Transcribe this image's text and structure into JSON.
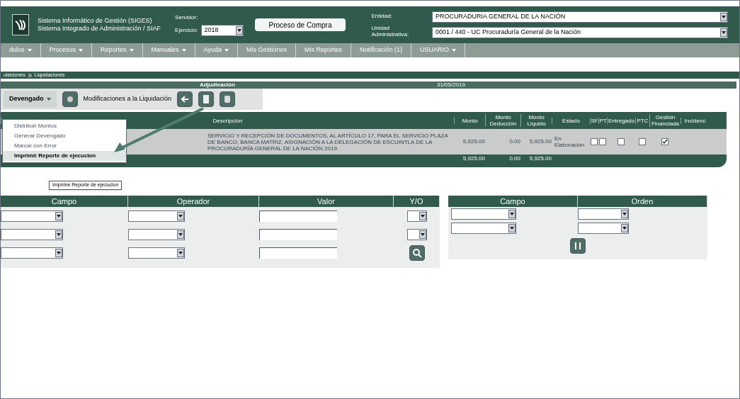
{
  "header": {
    "system_lines": [
      "Sistema Informático de Gestión (SIGES)",
      "Sistema Integrado de Administración / SIAF"
    ],
    "server_label": "Servidor:",
    "year_label": "Ejercicio:",
    "year": "2018",
    "process_button": "Proceso de Compra",
    "entity_label": "Entidad:",
    "unit_label": "Unidad Administrativa:",
    "entity": "PROCURADURIA GENERAL DE LA NACIÓN",
    "unit": "0001 / 440 - UC Procuraduría General de la Nación"
  },
  "menu": [
    {
      "label": "dulos",
      "dropdown": true
    },
    {
      "label": "Procesos",
      "dropdown": true
    },
    {
      "label": "Reportes",
      "dropdown": true
    },
    {
      "label": "Manuales",
      "dropdown": true
    },
    {
      "label": "Ayuda",
      "dropdown": true
    },
    {
      "label": "Mis Gestiones",
      "dropdown": false
    },
    {
      "label": "Mis Reportes",
      "dropdown": false
    },
    {
      "label": "Notificación (1)",
      "dropdown": false
    },
    {
      "label": "USUARIO",
      "dropdown": true
    }
  ],
  "breadcrumb": [
    "uisiciones",
    "Liquidaciones"
  ],
  "panel": {
    "title": "Adjudicación",
    "date": "31/05/2019"
  },
  "toolbar": {
    "devengado": "Devengado",
    "modificaciones": "Modificaciones a la Liquidación"
  },
  "dropdown_menu": [
    {
      "label": "Distribuir Montos",
      "selected": false
    },
    {
      "label": "Generar Devengado",
      "selected": false
    },
    {
      "label": "Marcar con Error",
      "selected": false
    },
    {
      "label": "Imprimir Reporte de ejecucion",
      "selected": true
    }
  ],
  "tooltip": "Imprime Reporte de ejecucion",
  "grid": {
    "columns": [
      "Descripción",
      "Monto",
      "Monto Deducción",
      "Monto Líquido",
      "Estado",
      "SF",
      "PT",
      "Entregado",
      "PTC",
      "Gestión Financiada",
      "Incidenc"
    ],
    "rows": [
      {
        "description": "SERVICIO Y RECEPCIÓN DE DOCUMENTOS, AL ARTÍCULO 17, PARA EL SERVICIO PLAZA DE BANCO, BANCA MATRIZ, ASIGNACIÓN A LA DELEGACIÓN DE ESCUINTLA DE LA PROCURADURÍA GENERAL DE LA NACIÓN 2019",
        "monto": "5,925.00",
        "deduccion": "0.00",
        "liquido": "5,925.00",
        "estado": "En Elaboración",
        "sf": false,
        "pt": false,
        "entregado": false,
        "ptc": false,
        "financiada": true
      }
    ],
    "totals": {
      "monto": "5,925.00",
      "deduccion": "0.00",
      "liquido": "5,925.00"
    }
  },
  "filter": {
    "columns": [
      "Campo",
      "Operador",
      "Valor",
      "Y/O"
    ],
    "rows": [
      {
        "conjunction": true
      },
      {
        "conjunction": true
      },
      {
        "conjunction": false
      }
    ]
  },
  "sort": {
    "columns": [
      "Campo",
      "Orden"
    ]
  }
}
